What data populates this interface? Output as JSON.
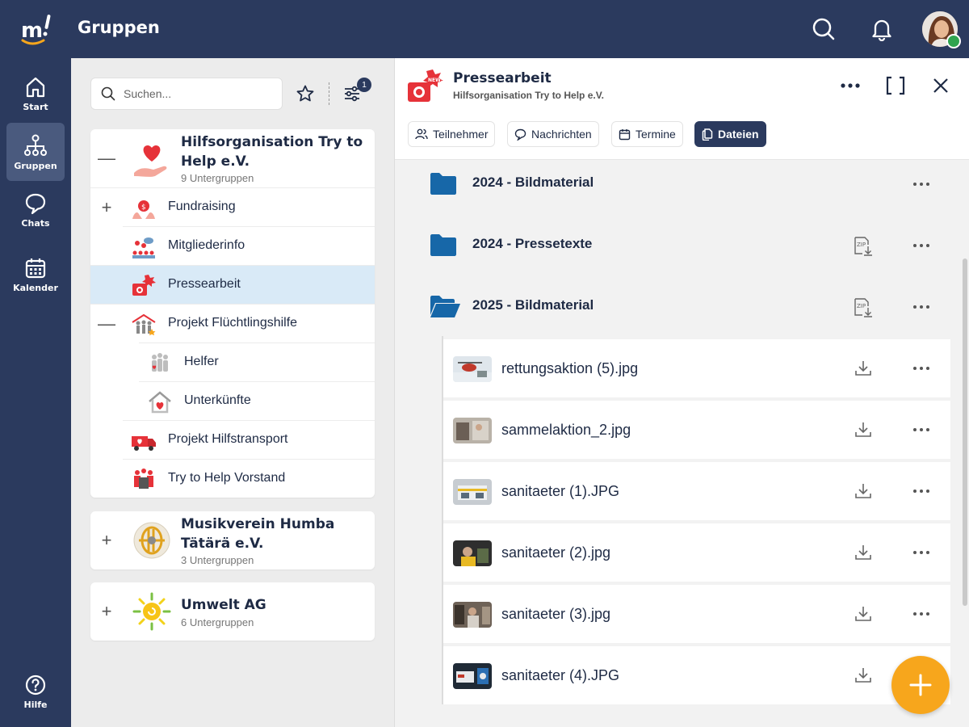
{
  "header": {
    "title": "Gruppen"
  },
  "sidebar": {
    "items": [
      {
        "label": "Start",
        "icon": "home-icon"
      },
      {
        "label": "Gruppen",
        "icon": "org-chart-icon",
        "active": true
      },
      {
        "label": "Chats",
        "icon": "chat-bubble-icon"
      },
      {
        "label": "Kalender",
        "icon": "calendar-icon"
      }
    ],
    "help_label": "Hilfe"
  },
  "groups_panel": {
    "search_placeholder": "Suchen...",
    "filter_count": "1",
    "groups": [
      {
        "name": "Hilfsorganisation Try to Help e.V.",
        "name_line1": "Hilfsorganisation Try to",
        "name_line2": "Help e.V.",
        "subgroups": "9 Untergruppen",
        "expanded": true,
        "children": [
          {
            "label": "Fundraising",
            "expandable": true
          },
          {
            "label": "Mitgliederinfo"
          },
          {
            "label": "Pressearbeit",
            "active": true
          },
          {
            "label": "Projekt Flüchtlingshilfe",
            "expanded": true
          },
          {
            "label": "Helfer",
            "level": 2
          },
          {
            "label": "Unterkünfte",
            "level": 2
          },
          {
            "label": "Projekt Hilfstransport"
          },
          {
            "label": "Try to Help Vorstand"
          }
        ]
      },
      {
        "name_line1": "Musikverein Humba",
        "name_line2": "Tätärä e.V.",
        "subgroups": "3 Untergruppen",
        "expanded": false
      },
      {
        "name_line1": "Umwelt AG",
        "subgroups": "6 Untergruppen",
        "expanded": false
      }
    ]
  },
  "detail": {
    "title": "Pressearbeit",
    "subtitle": "Hilfsorganisation Try to Help e.V.",
    "tabs": [
      {
        "label": "Teilnehmer",
        "icon": "people-icon"
      },
      {
        "label": "Nachrichten",
        "icon": "message-icon"
      },
      {
        "label": "Termine",
        "icon": "calendar-icon"
      },
      {
        "label": "Dateien",
        "icon": "files-icon",
        "active": true
      }
    ],
    "folders": [
      {
        "name": "2024 - Bildmaterial",
        "state": "closed",
        "zip": false
      },
      {
        "name": "2024 - Pressetexte",
        "state": "closed",
        "zip": true
      },
      {
        "name": "2025 - Bildmaterial",
        "state": "open",
        "zip": true
      }
    ],
    "files": [
      {
        "name": "rettungsaktion (5).jpg"
      },
      {
        "name": "sammelaktion_2.jpg"
      },
      {
        "name": "sanitaeter (1).JPG"
      },
      {
        "name": "sanitaeter (2).jpg"
      },
      {
        "name": "sanitaeter (3).jpg"
      },
      {
        "name": "sanitaeter (4).JPG"
      }
    ],
    "zip_label": "ZIP"
  },
  "colors": {
    "navy": "#2b3a5e",
    "folder_blue": "#1767a8",
    "accent_orange": "#f7a61c",
    "selected_row": "#d9eaf7"
  }
}
